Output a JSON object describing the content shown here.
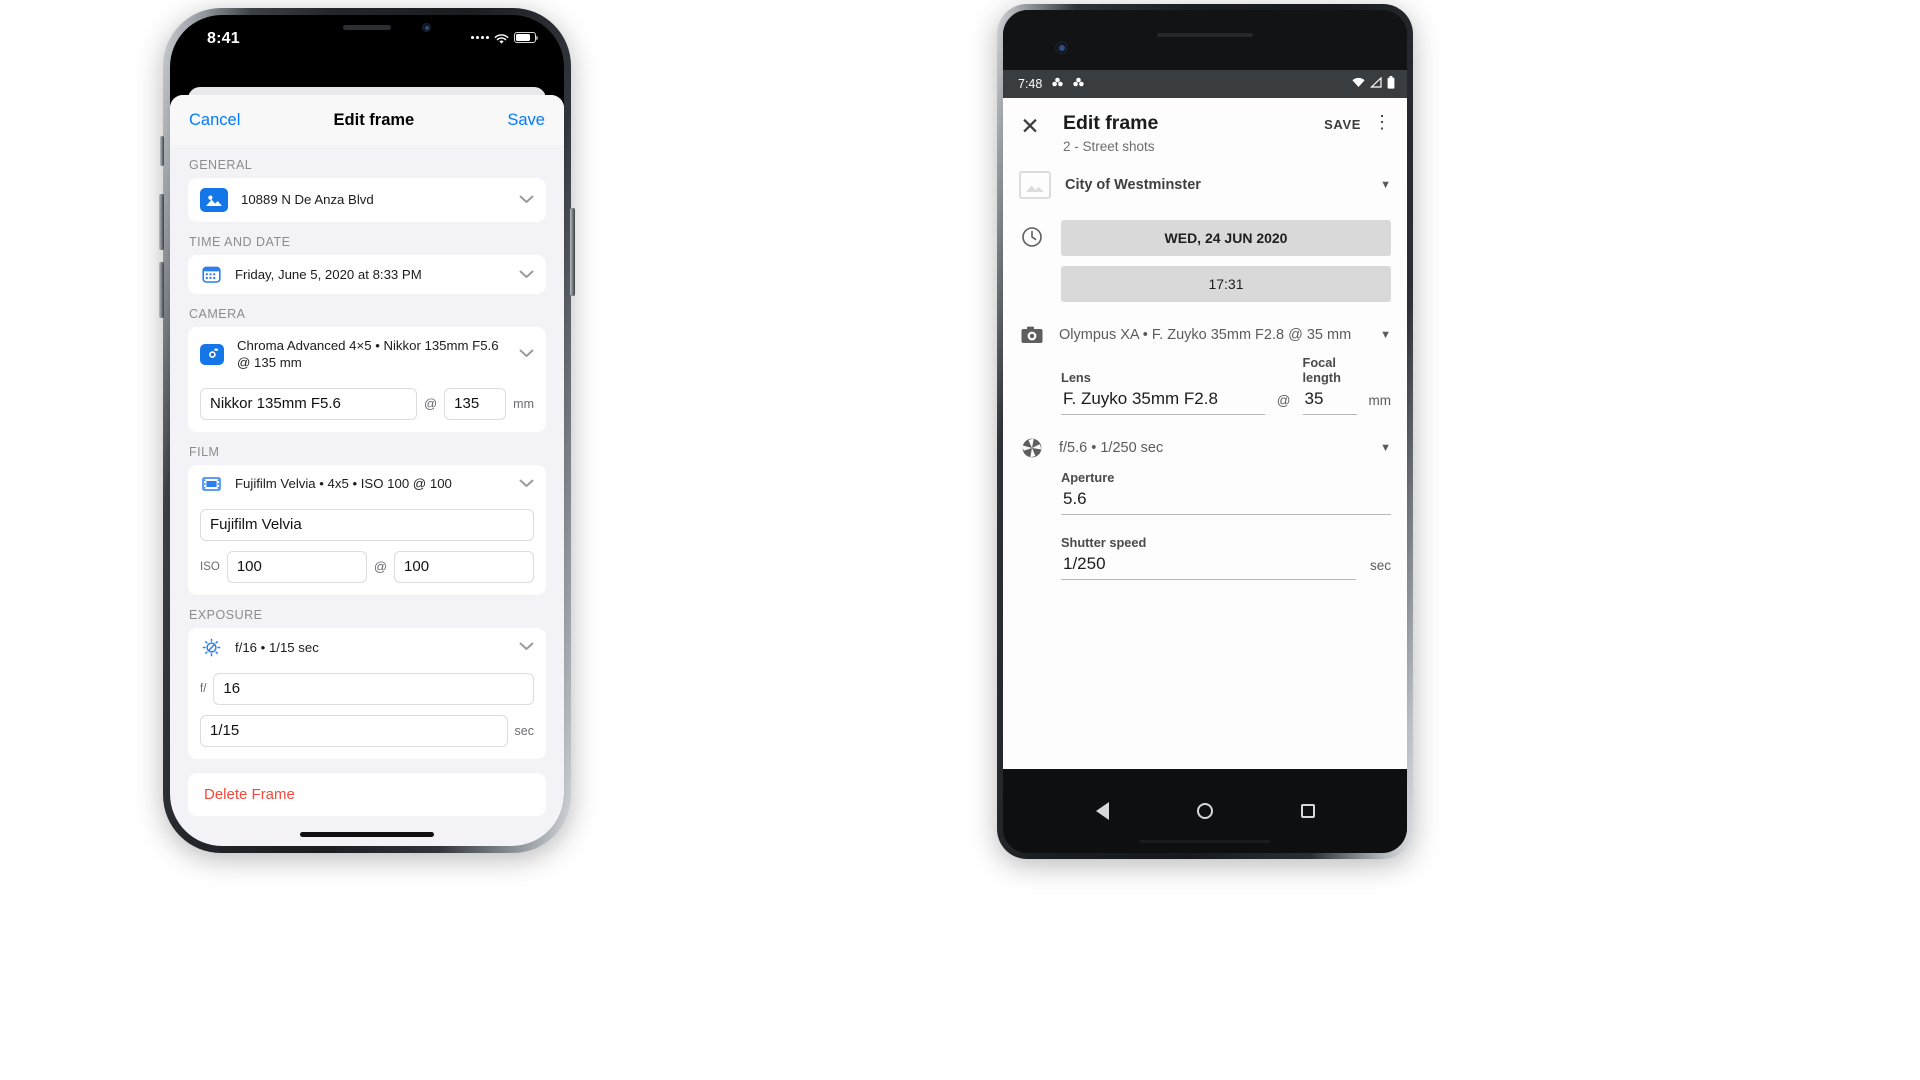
{
  "ios": {
    "status": {
      "time": "8:41",
      "wifi_icon": "wifi-icon",
      "battery_icon": "battery-icon"
    },
    "nav": {
      "cancel": "Cancel",
      "title": "Edit frame",
      "save": "Save"
    },
    "sections": [
      {
        "header": "GENERAL",
        "row": {
          "icon": "photo-icon",
          "text": "10889 N De Anza Blvd",
          "chevron": "chevron-down-icon"
        }
      },
      {
        "header": "TIME AND DATE",
        "row": {
          "icon": "calendar-icon",
          "text": "Friday, June 5, 2020 at 8:33 PM",
          "chevron": "chevron-down-icon"
        }
      },
      {
        "header": "CAMERA",
        "row": {
          "icon": "camera-icon",
          "text": "Chroma Advanced 4×5 • Nikkor 135mm F5.6 @ 135 mm",
          "chevron": "chevron-down-icon"
        },
        "lens_value": "Nikkor 135mm F5.6",
        "at": "@",
        "focal_value": "135",
        "focal_unit": "mm"
      },
      {
        "header": "FILM",
        "row": {
          "icon": "film-icon",
          "text": "Fujifilm Velvia • 4x5 • ISO 100 @ 100",
          "chevron": "chevron-down-icon"
        },
        "film_value": "Fujifilm Velvia",
        "iso_label": "ISO",
        "iso_value": "100",
        "at": "@",
        "iso_push_value": "100"
      },
      {
        "header": "EXPOSURE",
        "row": {
          "icon": "aperture-icon",
          "text": "f/16 • 1/15 sec",
          "chevron": "chevron-down-icon"
        },
        "fstop_label": "f/",
        "fstop_value": "16",
        "shutter_value": "1/15",
        "shutter_unit": "sec"
      }
    ],
    "delete_label": "Delete Frame"
  },
  "android": {
    "status": {
      "time": "7:48",
      "notif_icons": [
        "app-icon",
        "app-icon"
      ],
      "wifi_icon": "wifi-icon",
      "signal_icon": "signal-icon",
      "battery_icon": "battery-icon"
    },
    "appbar": {
      "close_icon": "close-icon",
      "title": "Edit frame",
      "subtitle": "2 - Street shots",
      "save": "SAVE",
      "overflow_icon": "more-vert-icon"
    },
    "location": {
      "icon": "image-placeholder-icon",
      "text": "City of Westminster",
      "caret": "chevron-down-icon"
    },
    "datetime": {
      "icon": "clock-icon",
      "date_chip": "WED, 24 JUN 2020",
      "time_chip": "17:31"
    },
    "camera": {
      "icon": "camera-icon",
      "summary": "Olympus XA • F. Zuyko 35mm F2.8 @ 35 mm",
      "lens_label": "Lens",
      "lens_value": "F. Zuyko 35mm F2.8",
      "at": "@",
      "focal_label": "Focal length",
      "focal_value": "35",
      "focal_unit": "mm",
      "caret": "chevron-down-icon"
    },
    "exposure": {
      "icon": "aperture-icon",
      "summary": "f/5.6 • 1/250 sec",
      "aperture_label": "Aperture",
      "aperture_value": "5.6",
      "shutter_label": "Shutter speed",
      "shutter_value": "1/250",
      "shutter_unit": "sec",
      "caret": "chevron-down-icon"
    },
    "navbar": {
      "back_icon": "back-triangle-icon",
      "home_icon": "home-circle-icon",
      "recents_icon": "recents-square-icon"
    }
  }
}
